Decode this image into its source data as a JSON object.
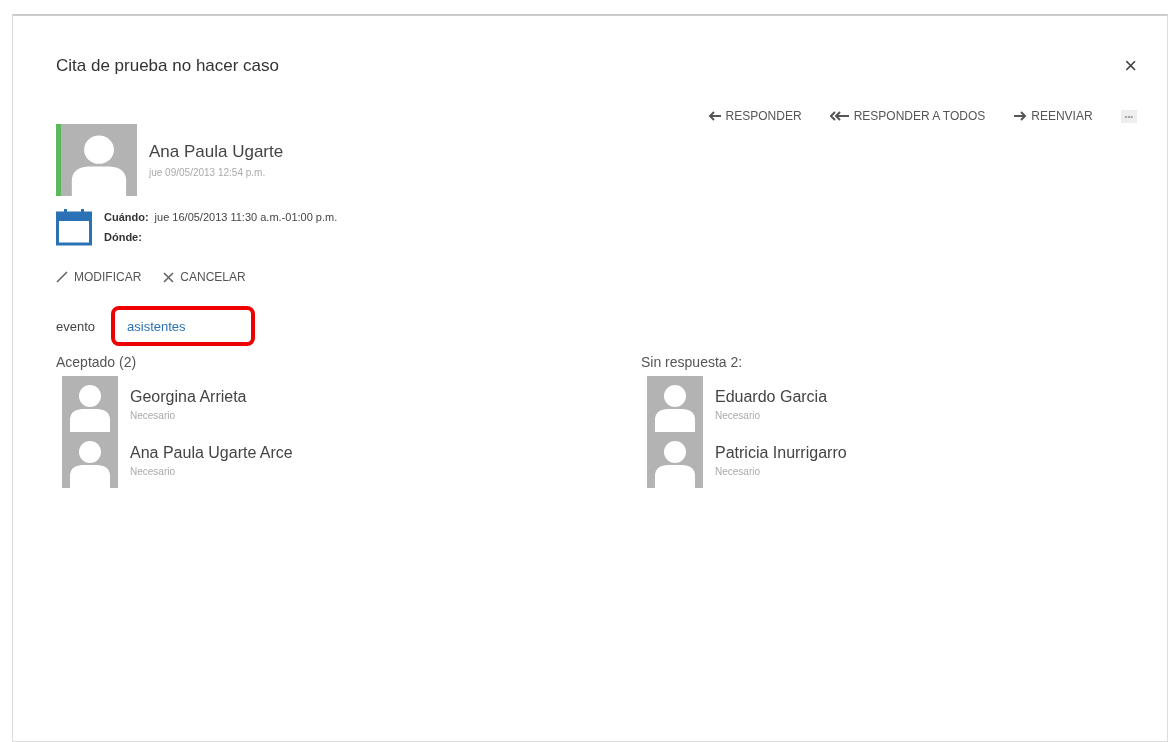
{
  "title": "Cita de prueba no hacer caso",
  "close": "×",
  "actions": [
    {
      "kind": "reply",
      "label": "RESPONDER"
    },
    {
      "kind": "reply-all",
      "label": "RESPONDER A TODOS"
    },
    {
      "kind": "forward",
      "label": "REENVIAR"
    },
    {
      "kind": "more",
      "label": "•••"
    }
  ],
  "sender": {
    "name": "Ana Paula Ugarte",
    "sent": "jue 09/05/2013 12:54 p.m."
  },
  "details": [
    {
      "label": "Cuándo:",
      "value": "jue 16/05/2013 11:30 a.m.-01:00 p.m."
    },
    {
      "label": "Dónde:"
    }
  ],
  "commands": [
    {
      "kind": "edit",
      "label": "MODIFICAR"
    },
    {
      "kind": "cancel",
      "label": "CANCELAR"
    }
  ],
  "view_tabs": [
    {
      "label": "evento",
      "selected": false,
      "highlighted": false
    },
    {
      "label": "asistentes",
      "selected": true,
      "highlighted": true
    }
  ],
  "groups": [
    {
      "title": "Aceptado (2)",
      "attendees": [
        {
          "name": "Georgina Arrieta",
          "role": "Necesario"
        },
        {
          "name": "Ana Paula Ugarte Arce",
          "role": "Necesario"
        }
      ]
    },
    {
      "title": "Sin respuesta 2:",
      "attendees": [
        {
          "name": "Eduardo Garcia",
          "role": "Necesario"
        },
        {
          "name": "Patricia Inurrigarro",
          "role": "Necesario"
        }
      ]
    }
  ]
}
